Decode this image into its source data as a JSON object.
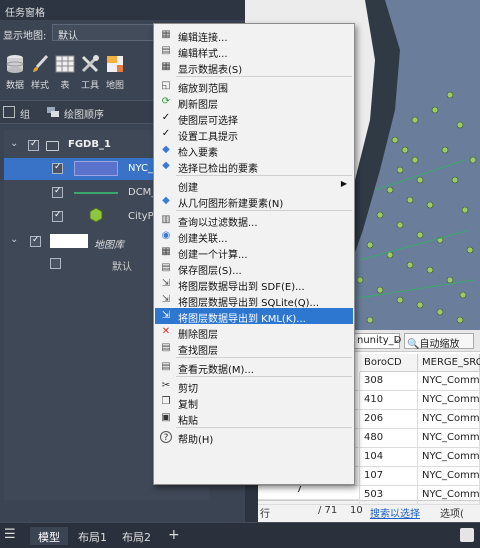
{
  "pane": {
    "title": "任务窗格",
    "map_label": "显示地图:",
    "map_value": "默认",
    "tools": [
      {
        "label": "数据",
        "icon": "database-icon"
      },
      {
        "label": "样式",
        "icon": "brush-icon"
      },
      {
        "label": "表",
        "icon": "table-icon"
      },
      {
        "label": "工具",
        "icon": "tools-icon"
      },
      {
        "label": "地图",
        "icon": "map-icon"
      }
    ],
    "group_label": "组",
    "draw_order_label": "绘图顺序"
  },
  "tree": {
    "root": "FGDB_1",
    "layers": [
      {
        "name": "NYC_C",
        "type": "polygon",
        "selected": true
      },
      {
        "name": "DCM_",
        "type": "line",
        "selected": false
      },
      {
        "name": "CityPl",
        "type": "point",
        "selected": false
      }
    ],
    "basemap_group": "地图库",
    "basemap_item": "默认"
  },
  "menu": {
    "items": [
      {
        "label": "编辑连接...",
        "icon": "connection-icon"
      },
      {
        "label": "编辑样式...",
        "icon": "style-icon"
      },
      {
        "label": "显示数据表(S)",
        "icon": "table-icon"
      },
      {
        "sep": true
      },
      {
        "label": "缩放到范围",
        "icon": "zoom-extent-icon"
      },
      {
        "label": "刷新图层",
        "icon": "refresh-icon"
      },
      {
        "label": "使图层可选择",
        "icon": "check-icon"
      },
      {
        "label": "设置工具提示",
        "icon": "check-icon"
      },
      {
        "label": "检入要素",
        "icon": "checkin-icon"
      },
      {
        "label": "选择已检出的要素",
        "icon": "checkout-icon"
      },
      {
        "sep": true
      },
      {
        "label": "创建",
        "icon": "",
        "submenu": true
      },
      {
        "label": "从几何图形新建要素(N)",
        "icon": "geometry-icon"
      },
      {
        "sep": true
      },
      {
        "label": "查询以过滤数据...",
        "icon": "query-icon"
      },
      {
        "label": "创建关联...",
        "icon": "join-icon"
      },
      {
        "label": "创建一个计算...",
        "icon": "calculate-icon"
      },
      {
        "label": "保存图层(S)...",
        "icon": "save-layer-icon"
      },
      {
        "label": "将图层数据导出到 SDF(E)...",
        "icon": "export-icon"
      },
      {
        "label": "将图层数据导出到 SQLite(Q)...",
        "icon": "export-icon"
      },
      {
        "label": "将图层数据导出到 KML(K)...",
        "icon": "export-icon",
        "highlight": true
      },
      {
        "label": "删除图层",
        "icon": "delete-icon"
      },
      {
        "label": "查找图层",
        "icon": "find-icon"
      },
      {
        "sep": true
      },
      {
        "label": "查看元数据(M)...",
        "icon": "metadata-icon"
      },
      {
        "sep": true
      },
      {
        "label": "剪切",
        "icon": "cut-icon"
      },
      {
        "label": "复制",
        "icon": "copy-icon"
      },
      {
        "label": "粘贴",
        "icon": "paste-icon"
      },
      {
        "sep": true
      },
      {
        "label": "帮助(H)",
        "icon": "help-icon"
      }
    ]
  },
  "datatable": {
    "combo_value": "nunity_D",
    "autozoom_label": "自动缩放",
    "columns": [
      "BoroCD",
      "MERGE_SRC"
    ],
    "rows": [
      {
        "BoroCD": "308",
        "MERGE_SRC": "NYC_Commu"
      },
      {
        "BoroCD": "410",
        "MERGE_SRC": "NYC_Commu"
      },
      {
        "BoroCD": "206",
        "MERGE_SRC": "NYC_Commu"
      },
      {
        "BoroCD": "480",
        "MERGE_SRC": "NYC_Commu"
      },
      {
        "BoroCD": "104",
        "MERGE_SRC": "NYC_Commu"
      },
      {
        "BoroCD": "107",
        "MERGE_SRC": "NYC_Commu"
      },
      {
        "BoroCD": "503",
        "MERGE_SRC": "NYC_Commu"
      }
    ],
    "last_row_index": "7",
    "footer": {
      "row_label": "行",
      "count": "/ 71",
      "page": "10",
      "select_link": "搜索以选择",
      "options": "选项("
    }
  },
  "tabs": {
    "model": "模型",
    "layout1": "布局1",
    "layout2": "布局2",
    "add": "+"
  },
  "colors": {
    "highlight": "#2e77d0",
    "polygon_fill": "#5b72cc",
    "line": "#3aa86b",
    "point": "#8ec63f",
    "map_feature": "#6a7e9b"
  }
}
